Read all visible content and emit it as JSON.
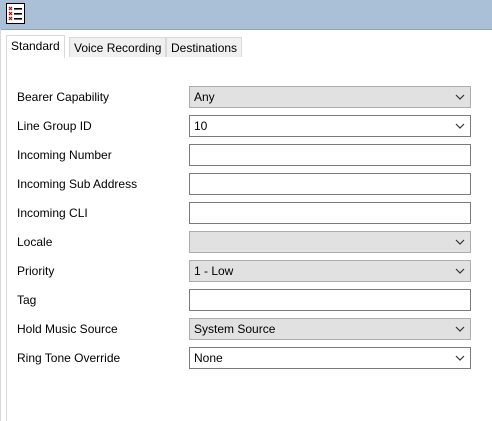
{
  "window": {
    "icon": "list-settings-icon"
  },
  "tabs": [
    {
      "label": "Standard",
      "active": true
    },
    {
      "label": "Voice Recording",
      "active": false
    },
    {
      "label": "Destinations",
      "active": false
    }
  ],
  "form": {
    "bearer_capability": {
      "label": "Bearer Capability",
      "value": "Any"
    },
    "line_group_id": {
      "label": "Line Group ID",
      "value": "10"
    },
    "incoming_number": {
      "label": "Incoming Number",
      "value": ""
    },
    "incoming_sub_address": {
      "label": "Incoming Sub Address",
      "value": ""
    },
    "incoming_cli": {
      "label": "Incoming CLI",
      "value": ""
    },
    "locale": {
      "label": "Locale",
      "value": ""
    },
    "priority": {
      "label": "Priority",
      "value": "1 - Low"
    },
    "tag": {
      "label": "Tag",
      "value": ""
    },
    "hold_music_source": {
      "label": "Hold Music Source",
      "value": "System Source"
    },
    "ring_tone_override": {
      "label": "Ring Tone Override",
      "value": "None"
    }
  }
}
